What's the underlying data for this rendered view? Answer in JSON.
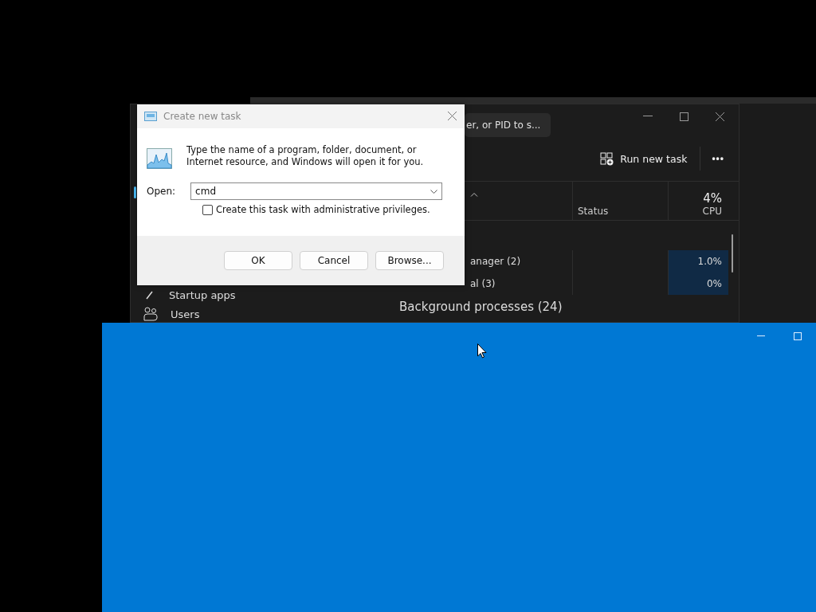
{
  "task_manager": {
    "search": {
      "placeholder": "er, or PID to s..."
    },
    "toolbar": {
      "run_new_task": "Run new task",
      "more": "•••"
    },
    "sidebar": {
      "items": [
        {
          "kind": "startup",
          "label": "Startup apps",
          "selected": false
        },
        {
          "kind": "users",
          "label": "Users",
          "selected": false
        }
      ]
    },
    "columns": [
      {
        "label": "Status"
      },
      {
        "value": "4%",
        "label": "CPU"
      }
    ],
    "rows": [
      {
        "name": "anager (2)",
        "cpu": "1.0%"
      },
      {
        "name": "al (3)",
        "cpu": "0%"
      }
    ],
    "group": "Background processes (24)"
  },
  "dialog": {
    "title": "Create new task",
    "message": "Type the name of a program, folder, document, or Internet resource, and Windows will open it for you.",
    "open_label": "Open:",
    "open_value": "cmd",
    "admin": {
      "label": "Create this task with administrative privileges.",
      "checked": false
    },
    "buttons": [
      "OK",
      "Cancel",
      "Browse..."
    ]
  }
}
